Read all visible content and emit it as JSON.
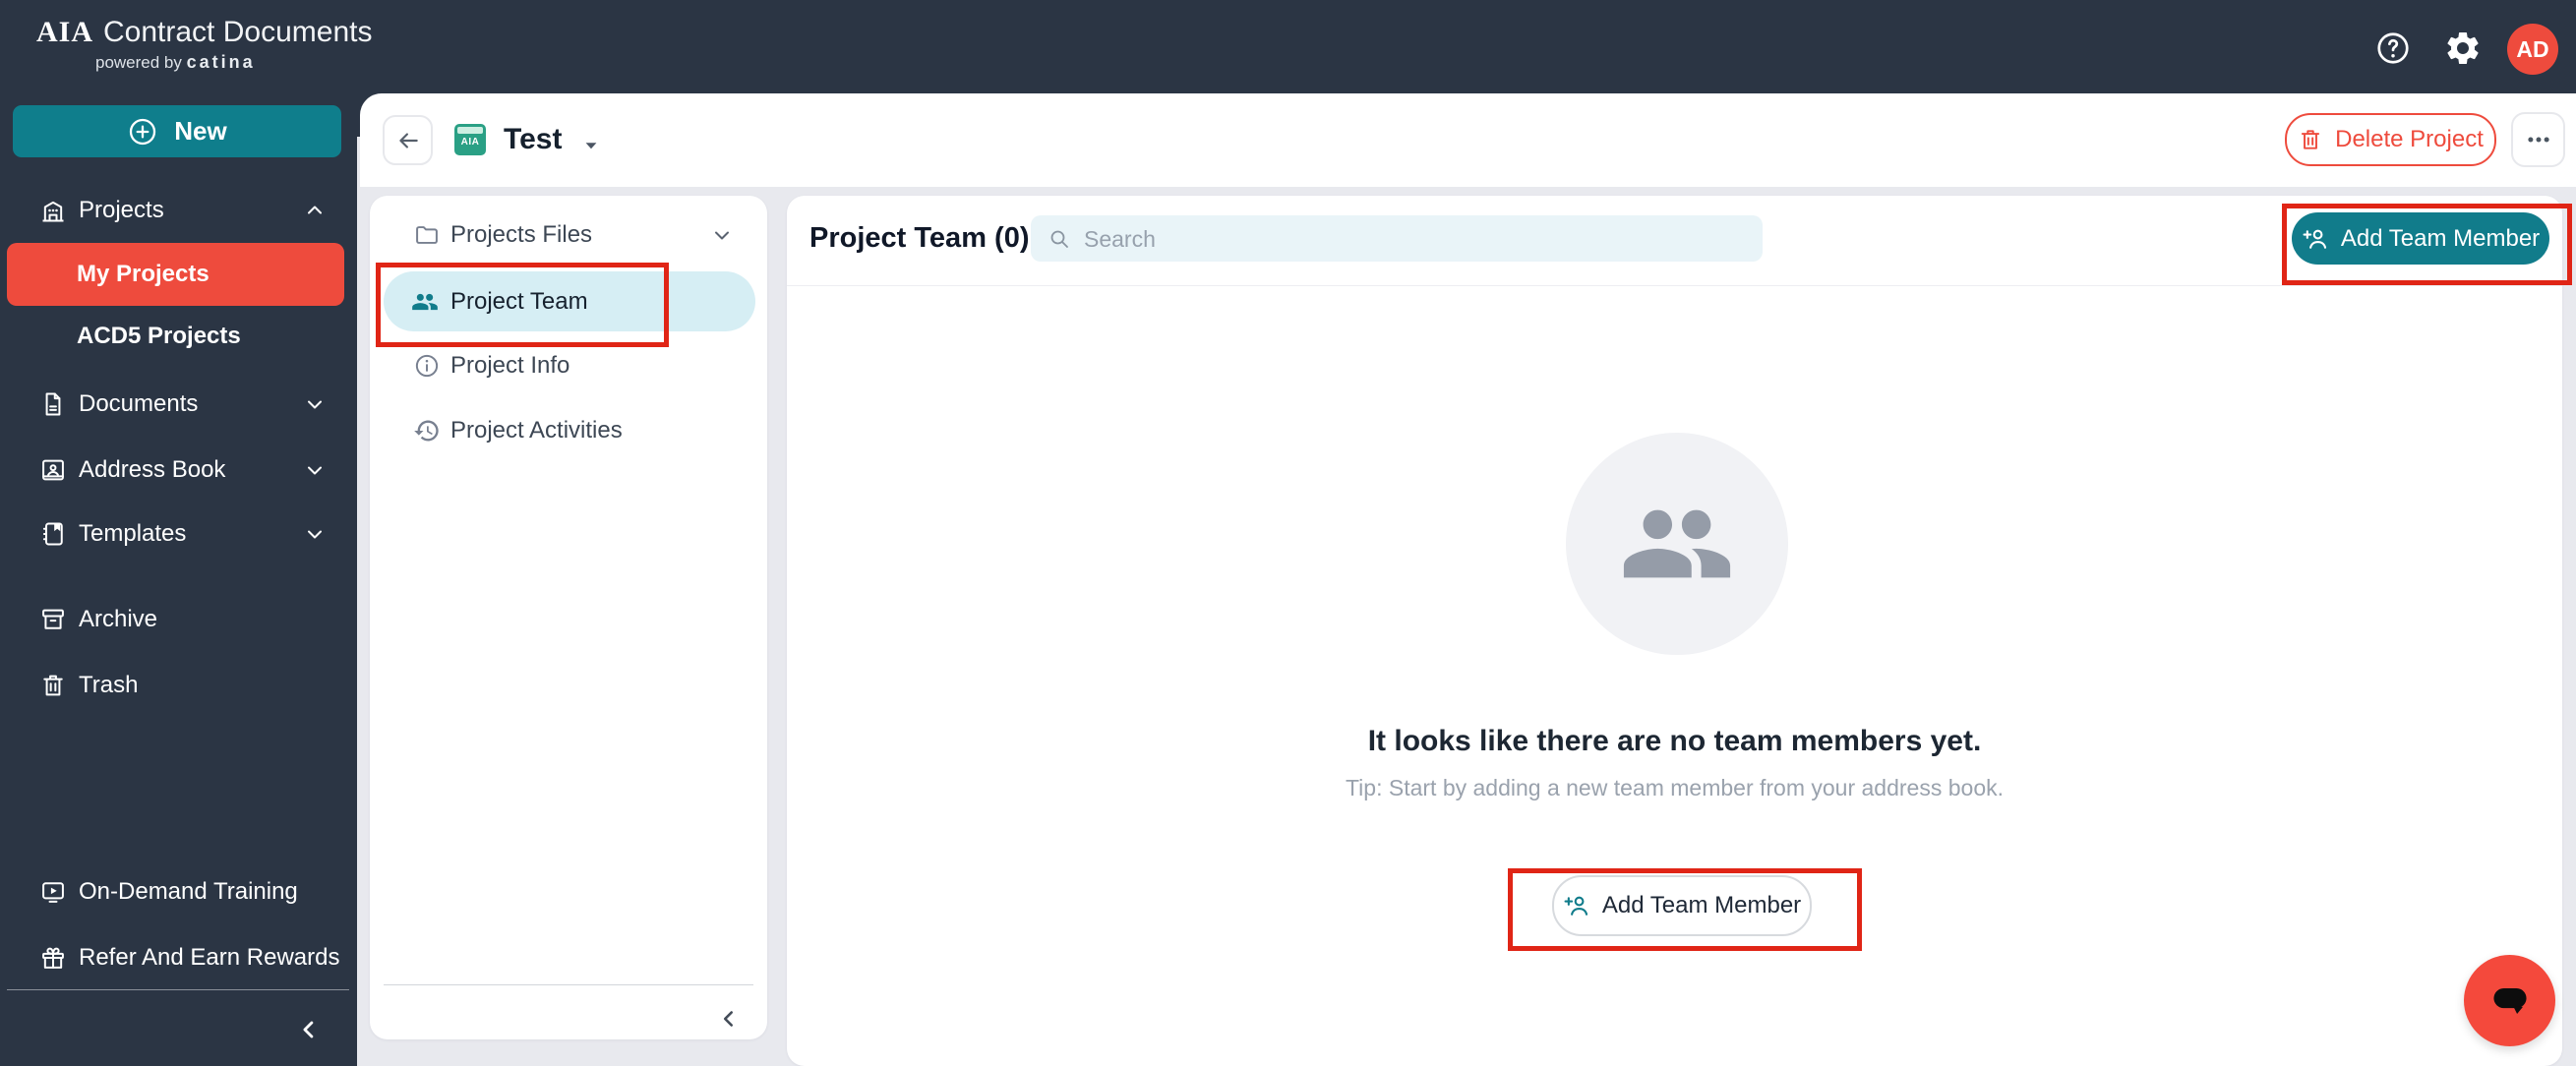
{
  "topbar": {
    "logo_primary": "AIA",
    "logo_secondary": "Contract Documents",
    "powered_prefix": "powered by",
    "powered_brand": "catina",
    "avatar_initials": "AD"
  },
  "sidebar": {
    "new_button": "New",
    "projects": "Projects",
    "my_projects": "My Projects",
    "acd5_projects": "ACD5 Projects",
    "documents": "Documents",
    "address_book": "Address Book",
    "templates": "Templates",
    "archive": "Archive",
    "trash": "Trash",
    "training": "On-Demand Training",
    "refer": "Refer And Earn Rewards"
  },
  "project_header": {
    "title": "Test",
    "icon_text": "AIA",
    "delete_button": "Delete Project"
  },
  "project_nav": {
    "files": "Projects Files",
    "team": "Project Team",
    "info": "Project Info",
    "activities": "Project Activities"
  },
  "team_panel": {
    "title": "Project Team (0)",
    "search_placeholder": "Search",
    "add_button": "Add Team Member",
    "empty_title": "It looks like there are no team members yet.",
    "empty_tip": "Tip: Start by adding a new team member from your address book.",
    "empty_add_button": "Add Team Member"
  },
  "colors": {
    "navy": "#2b3544",
    "teal": "#117c8b",
    "red": "#ee4b3d",
    "annotation_red": "#e02516",
    "highlight_cyan": "#d6eef4",
    "page_bg": "#e8e9ee"
  }
}
